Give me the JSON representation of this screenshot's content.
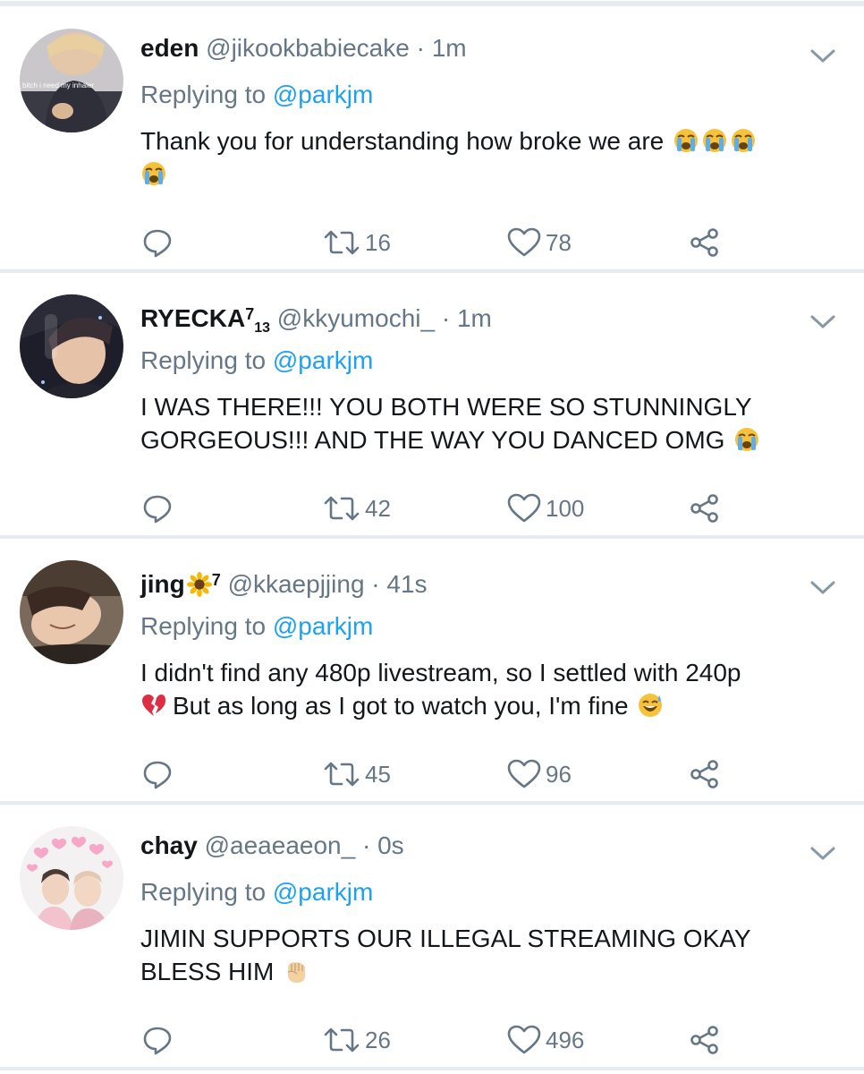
{
  "replying_prefix": "Replying to",
  "colors": {
    "link": "#1da1f2",
    "muted": "#657786",
    "text": "#14171a",
    "divider": "#e6ecf0"
  },
  "avatar_1_caption": "bitch i need my inhaler",
  "tweets": [
    {
      "name": "eden",
      "name_sup": "",
      "name_sub": "",
      "handle": "@jikookbabiecake",
      "sep": "·",
      "time": "1m",
      "mention": "@parkjm",
      "text": "Thank you for understanding how broke we are",
      "emoji_icons": [
        "loudly-crying-face-icon",
        "loudly-crying-face-icon",
        "loudly-crying-face-icon",
        "loudly-crying-face-icon"
      ],
      "retweets": "16",
      "likes": "78"
    },
    {
      "name": "RYECKA",
      "name_sup": "7",
      "name_sub": "13",
      "handle": "@kkyumochi_",
      "sep": "·",
      "time": "1m",
      "mention": "@parkjm",
      "text": "I WAS THERE!!! YOU BOTH WERE SO STUNNINGLY GORGEOUS!!! AND THE WAY YOU DANCED OMG",
      "emoji_icons": [
        "loudly-crying-face-icon"
      ],
      "retweets": "42",
      "likes": "100"
    },
    {
      "name": "jing",
      "name_sup": "7",
      "name_sub": "",
      "handle": "@kkaepjjing",
      "sep": "·",
      "time": "41s",
      "mention": "@parkjm",
      "text_a": "I didn't find any 480p livestream, so I settled with 240p",
      "text_b": "But as long as I got to watch you, I'm fine",
      "emoji_icons": [
        "sunflower-icon",
        "broken-heart-icon",
        "grinning-sweat-face-icon"
      ],
      "retweets": "45",
      "likes": "96"
    },
    {
      "name": "chay",
      "name_sup": "",
      "name_sub": "",
      "handle": "@aeaeaeon_",
      "sep": "·",
      "time": "0s",
      "mention": "@parkjm",
      "text": "JIMIN SUPPORTS OUR ILLEGAL STREAMING OKAY BLESS HIM",
      "emoji_icons": [
        "raised-fist-icon"
      ],
      "retweets": "26",
      "likes": "496"
    }
  ]
}
